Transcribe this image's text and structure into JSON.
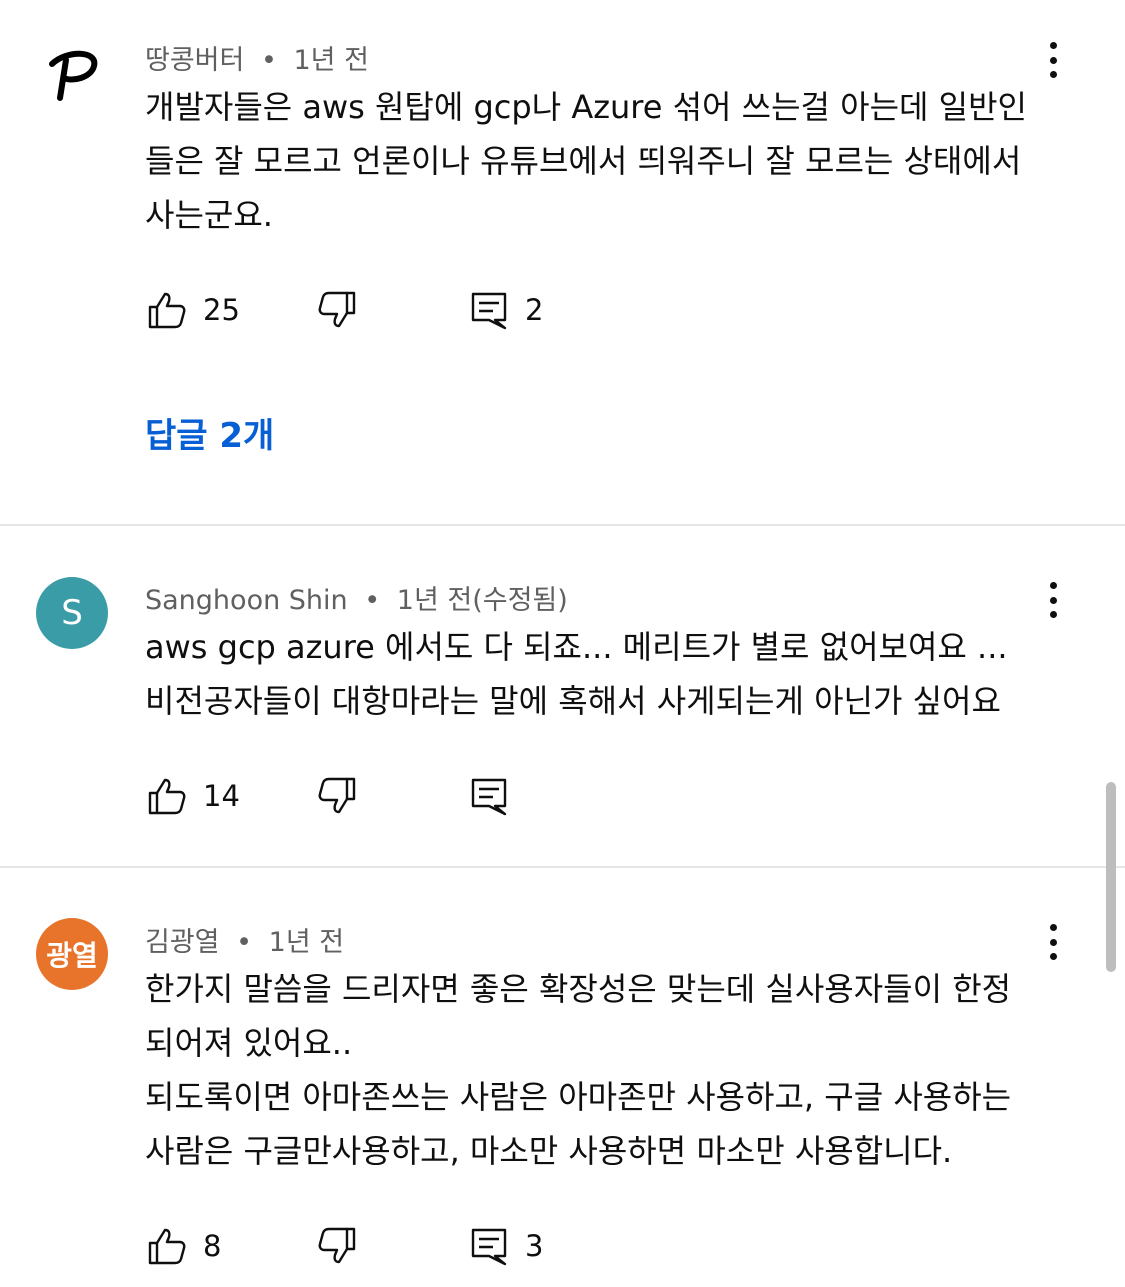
{
  "comments": [
    {
      "avatar_text": "",
      "avatar_icon": "P-logo-icon",
      "author": "땅콩버터",
      "separator": "•",
      "time": "1년 전",
      "lines": [
        "개발자들은 aws 원탑에 gcp나 Azure 섞어 쓰는걸 아는데 일반인",
        "들은 잘 모르고 언론이나 유튜브에서 띄워주니 잘 모르는 상태에서",
        "사는군요."
      ],
      "likes": "25",
      "replies_count": "2",
      "replies_link": "답글 2개"
    },
    {
      "avatar_text": "S",
      "avatar_color": "#3a9ca6",
      "author": "Sanghoon Shin",
      "separator": "•",
      "time": "1년 전(수정됨)",
      "lines": [
        "aws gcp azure 에서도 다 되죠... 메리트가 별로 없어보여요 ...",
        "비전공자들이 대항마라는 말에 혹해서 사게되는게 아닌가 싶어요"
      ],
      "likes": "14",
      "replies_count": ""
    },
    {
      "avatar_text": "광열",
      "avatar_color": "#e7742a",
      "author": "김광열",
      "separator": "•",
      "time": "1년 전",
      "lines": [
        "한가지 말씀을 드리자면 좋은 확장성은 맞는데 실사용자들이 한정",
        "되어져 있어요..",
        "되도록이면 아마존쓰는 사람은 아마존만 사용하고, 구글 사용하는",
        "사람은 구글만사용하고, 마소만 사용하면 마소만 사용합니다."
      ],
      "likes": "8",
      "replies_count": "3"
    }
  ],
  "icons": {
    "like": "thumbs-up-icon",
    "dislike": "thumbs-down-icon",
    "reply": "comment-icon",
    "menu": "more-vert-icon"
  },
  "colors": {
    "link": "#065fd4",
    "meta": "#606060",
    "divider": "#e5e5e5"
  }
}
